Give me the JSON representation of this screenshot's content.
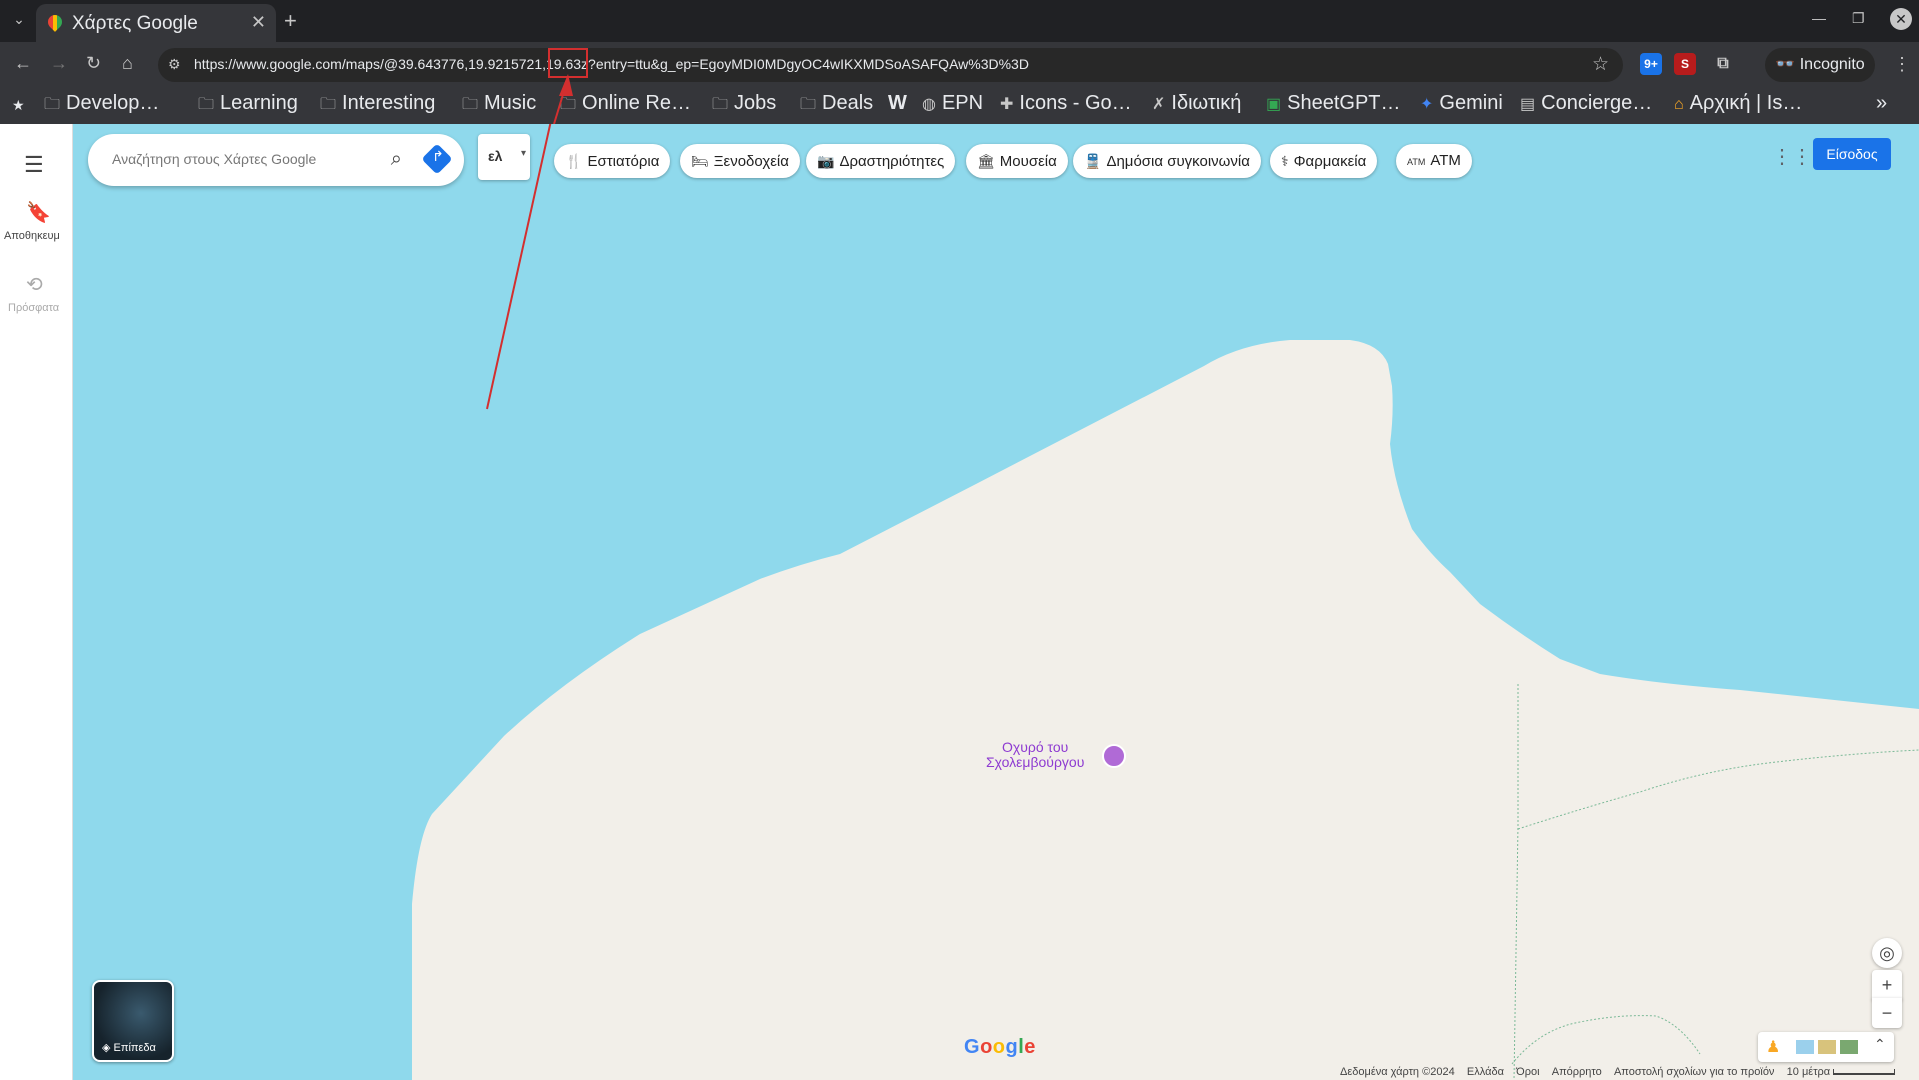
{
  "tab": {
    "title": "Χάρτες Google"
  },
  "url": "https://www.google.com/maps/@39.643776,19.9215721,19.63z?entry=ttu&g_ep=EgoyMDI0MDgyOC4wIKXMDSoASAFQAw%3D%3D",
  "incognito_label": "Incognito",
  "bookmarks": [
    {
      "label": "Develop…",
      "icon": "folder-icon"
    },
    {
      "label": "Learning",
      "icon": "folder-icon"
    },
    {
      "label": "Interesting",
      "icon": "folder-icon"
    },
    {
      "label": "Music",
      "icon": "folder-icon"
    },
    {
      "label": "Online Re…",
      "icon": "folder-icon"
    },
    {
      "label": "Jobs",
      "icon": "folder-icon"
    },
    {
      "label": "Deals",
      "icon": "folder-icon"
    },
    {
      "label": "",
      "icon": "w-icon"
    },
    {
      "label": "EPN",
      "icon": "globe-icon"
    },
    {
      "label": "Icons - Go…",
      "icon": "icons-icon"
    },
    {
      "label": "Ιδιωτική",
      "icon": "x-icon"
    },
    {
      "label": "SheetGPT…",
      "icon": "sheet-icon"
    },
    {
      "label": "Gemini",
      "icon": "gemini-icon"
    },
    {
      "label": "Concierge…",
      "icon": "concierge-icon"
    },
    {
      "label": "Αρχική | Is…",
      "icon": "home-icon"
    }
  ],
  "maps": {
    "search_placeholder": "Αναζήτηση στους Χάρτες Google",
    "lang": "ελ",
    "saved_label": "Αποθηκευμ",
    "recent_label": "Πρόσφατα",
    "chips": [
      "Εστιατόρια",
      "Ξενοδοχεία",
      "Δραστηριότητες",
      "Μουσεία",
      "Δημόσια συγκοινωνία",
      "Φαρμακεία",
      "ATM"
    ],
    "signin": "Είσοδος",
    "poi_line1": "Οχυρό του",
    "poi_line2": "Σχολεμβούργου",
    "layers_label": "Επίπεδα",
    "google_logo": "Google",
    "footer": {
      "data": "Δεδομένα χάρτη ©2024",
      "country": "Ελλάδα",
      "terms": "Όροι",
      "privacy": "Απόρρητο",
      "feedback": "Αποστολή σχολίων για το προϊόν",
      "scale": "10 μέτρα"
    }
  },
  "colors": {
    "water": "#8fd9ec",
    "land": "#f2efe9",
    "poi": "#8e3bd1",
    "accent": "#1a73e8",
    "annotation": "#d32f2f"
  }
}
